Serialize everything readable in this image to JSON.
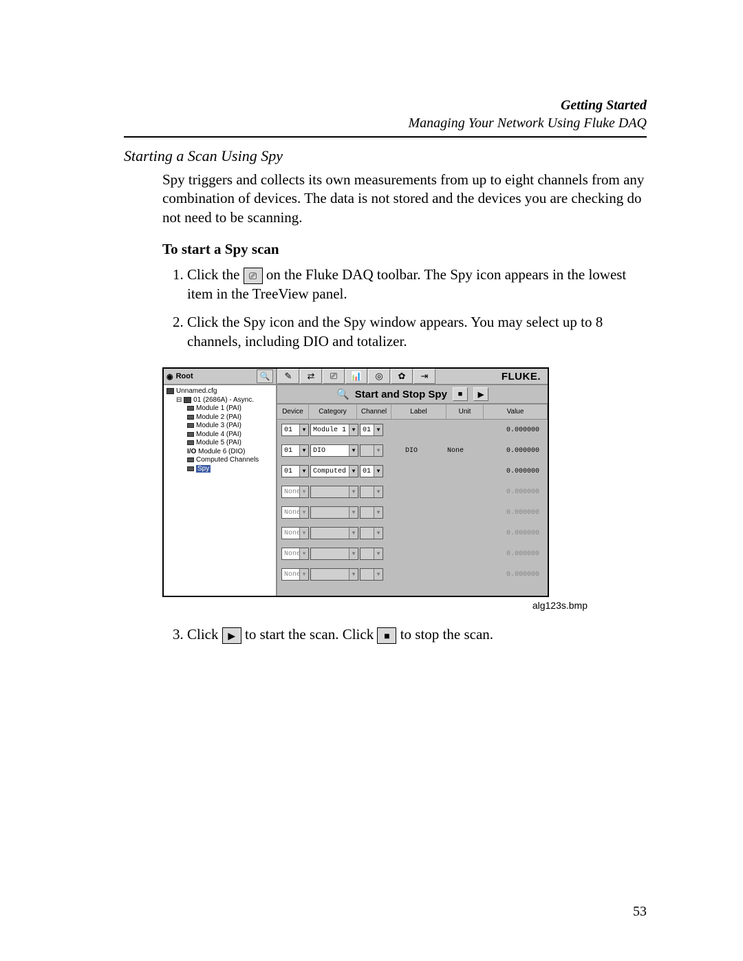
{
  "header": {
    "title": "Getting Started",
    "subtitle": "Managing Your Network Using Fluke DAQ"
  },
  "section_heading": "Starting a Scan Using Spy",
  "intro": "Spy triggers and collects its own measurements from up to eight channels from any combination of devices. The data is not stored and the devices you are checking do not need to be scanning.",
  "subhead": "To start a Spy scan",
  "step1_a": "Click the ",
  "step1_b": " on the Fluke DAQ toolbar. The Spy icon appears in the lowest item in the TreeView panel.",
  "step2": "Click the Spy icon and the Spy window appears. You may select up to 8 channels, including DIO and totalizer.",
  "step3_a": "Click ",
  "step3_b": " to start the scan. Click ",
  "step3_c": " to stop the scan.",
  "caption": "alg123s.bmp",
  "page_number": "53",
  "win": {
    "root_label": "Root",
    "fluke": "FLUKE.",
    "title": "Start and Stop Spy",
    "tree": {
      "top": "Unnamed.cfg",
      "dev": "01 (2686A) - Async.",
      "modules": [
        "Module 1 (PAI)",
        "Module 2 (PAI)",
        "Module 3 (PAI)",
        "Module 4 (PAI)",
        "Module 5 (PAI)",
        "Module 6 (DIO)"
      ],
      "mod6_prefix": "I/O",
      "computed": "Computed Channels",
      "spy": "Spy"
    },
    "cols": {
      "device": "Device",
      "category": "Category",
      "channel": "Channel",
      "label": "Label",
      "unit": "Unit",
      "value": "Value"
    },
    "rows": [
      {
        "device": "01",
        "category": "Module 1",
        "channel": "01",
        "label": "",
        "unit": "",
        "value": "0.000000",
        "disabledCat": false,
        "disabledChan": false,
        "dim": false
      },
      {
        "device": "01",
        "category": "DIO",
        "channel": "",
        "label": "DIO",
        "unit": "None",
        "value": "0.000000",
        "disabledCat": false,
        "disabledChan": true,
        "dim": false
      },
      {
        "device": "01",
        "category": "Computed",
        "channel": "01",
        "label": "",
        "unit": "",
        "value": "0.000000",
        "disabledCat": false,
        "disabledChan": false,
        "dim": false
      },
      {
        "device": "None",
        "category": "",
        "channel": "",
        "label": "",
        "unit": "",
        "value": "0.000000",
        "disabledCat": true,
        "disabledChan": true,
        "dim": true
      },
      {
        "device": "None",
        "category": "",
        "channel": "",
        "label": "",
        "unit": "",
        "value": "0.000000",
        "disabledCat": true,
        "disabledChan": true,
        "dim": true
      },
      {
        "device": "None",
        "category": "",
        "channel": "",
        "label": "",
        "unit": "",
        "value": "0.000000",
        "disabledCat": true,
        "disabledChan": true,
        "dim": true
      },
      {
        "device": "None",
        "category": "",
        "channel": "",
        "label": "",
        "unit": "",
        "value": "0.000000",
        "disabledCat": true,
        "disabledChan": true,
        "dim": true
      },
      {
        "device": "None",
        "category": "",
        "channel": "",
        "label": "",
        "unit": "",
        "value": "0.000000",
        "disabledCat": true,
        "disabledChan": true,
        "dim": true
      }
    ]
  }
}
